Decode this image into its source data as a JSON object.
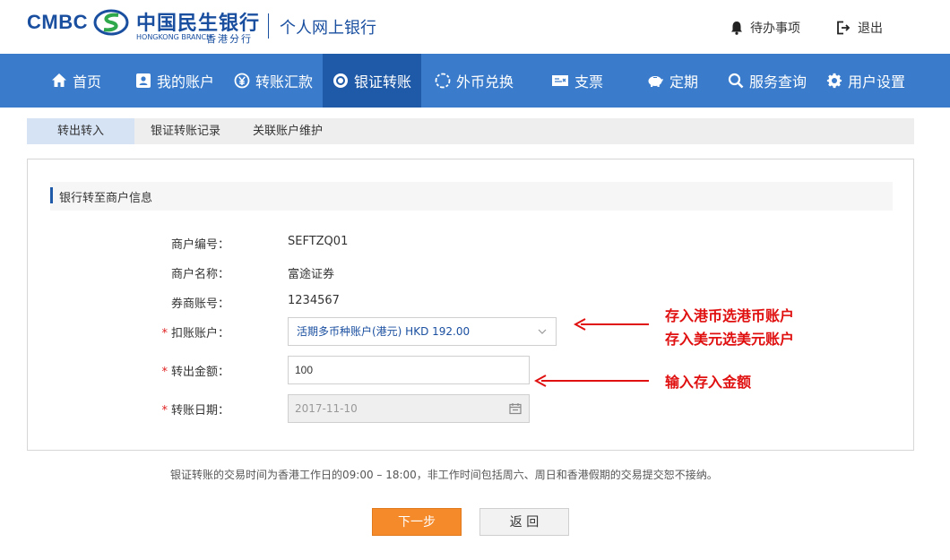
{
  "header": {
    "logo_text": "CMBC",
    "bank_name": "中国民生银行",
    "branch_en": "HONGKONG BRANCH",
    "branch_cn": "香港分行",
    "portal_title": "个人网上银行",
    "todo_label": "待办事项",
    "logout_label": "退出"
  },
  "nav": {
    "items": [
      {
        "label": "首页",
        "icon": "home-icon"
      },
      {
        "label": "我的账户",
        "icon": "account-card-icon"
      },
      {
        "label": "转账汇款",
        "icon": "yen-coin-icon"
      },
      {
        "label": "银证转账",
        "icon": "exchange-circle-icon"
      },
      {
        "label": "外币兑换",
        "icon": "currency-exchange-icon"
      },
      {
        "label": "支票",
        "icon": "cheque-icon"
      },
      {
        "label": "定期",
        "icon": "piggy-bank-icon"
      },
      {
        "label": "服务查询",
        "icon": "search-icon"
      },
      {
        "label": "用户设置",
        "icon": "gear-icon"
      }
    ],
    "active_index": 3
  },
  "subtabs": {
    "items": [
      "转出转入",
      "银证转账记录",
      "关联账户维护"
    ],
    "active_index": 0
  },
  "form": {
    "section_title": "银行转至商户信息",
    "merchant_id_label": "商户编号：",
    "merchant_id_value": "SEFTZQ01",
    "merchant_name_label": "商户名称：",
    "merchant_name_value": "富途证券",
    "broker_account_label": "券商账号：",
    "broker_account_value": "1234567",
    "debit_account_label": "扣账账户：",
    "debit_account_value": "活期多币种账户(港元) HKD 192.00",
    "amount_label": "转出金额：",
    "amount_value": "100",
    "date_label": "转账日期：",
    "date_value": "2017-11-10",
    "required_mark": "*"
  },
  "annotations": {
    "account_note_line1": "存入港币选港币账户",
    "account_note_line2": "存入美元选美元账户",
    "amount_note": "输入存入金额",
    "color": "#e01010"
  },
  "notice": "银证转账的交易时间为香港工作日的09:00 – 18:00，非工作时间包括周六、周日和香港假期的交易提交恕不接纳。",
  "buttons": {
    "next_label": "下一步",
    "back_label": "返 回"
  },
  "colors": {
    "nav_bg": "#3a7ccb",
    "nav_active": "#1e5aa8",
    "brand": "#1a4fa0",
    "next_button": "#f48a2a"
  }
}
